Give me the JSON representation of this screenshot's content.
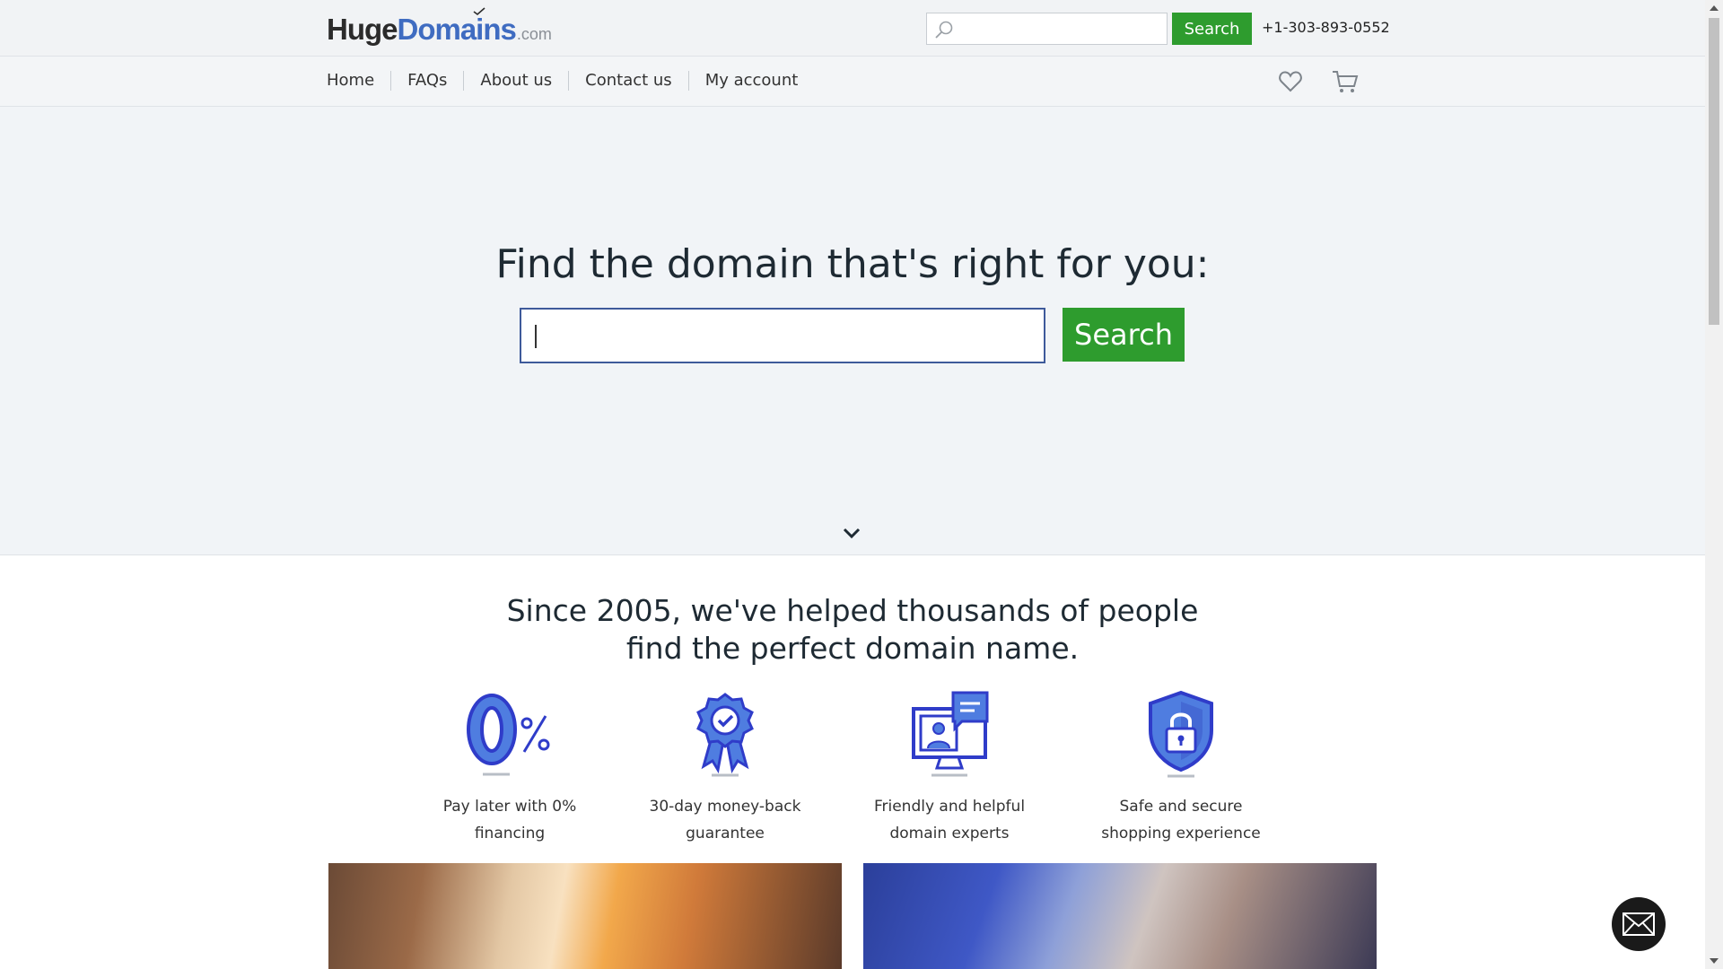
{
  "header": {
    "logo": {
      "part1": "Huge",
      "part2": "Domains",
      "tld": ".com"
    },
    "search": {
      "placeholder": "",
      "value": "",
      "button_label": "Search"
    },
    "phone": "+1-303-893-0552"
  },
  "nav": {
    "items": [
      {
        "label": "Home"
      },
      {
        "label": "FAQs"
      },
      {
        "label": "About us"
      },
      {
        "label": "Contact us"
      },
      {
        "label": "My account"
      }
    ],
    "icons": [
      "heart-icon",
      "cart-icon"
    ]
  },
  "hero": {
    "title": "Find the domain that's right for you:",
    "input_value": "",
    "button_label": "Search"
  },
  "features": {
    "heading_line1": "Since 2005, we've helped thousands of people",
    "heading_line2": "find the perfect domain name.",
    "items": [
      {
        "icon": "zero-percent-icon",
        "line1": "Pay later with 0%",
        "line2": "financing"
      },
      {
        "icon": "award-ribbon-icon",
        "line1": "30-day money-back",
        "line2": "guarantee"
      },
      {
        "icon": "support-monitor-icon",
        "line1": "Friendly and helpful",
        "line2": "domain experts"
      },
      {
        "icon": "shield-lock-icon",
        "line1": "Safe and secure",
        "line2": "shopping experience"
      }
    ]
  },
  "colors": {
    "brand_blue": "#3f6cc1",
    "action_green": "#2e9c2e",
    "icon_blue": "#2f3cc9"
  }
}
